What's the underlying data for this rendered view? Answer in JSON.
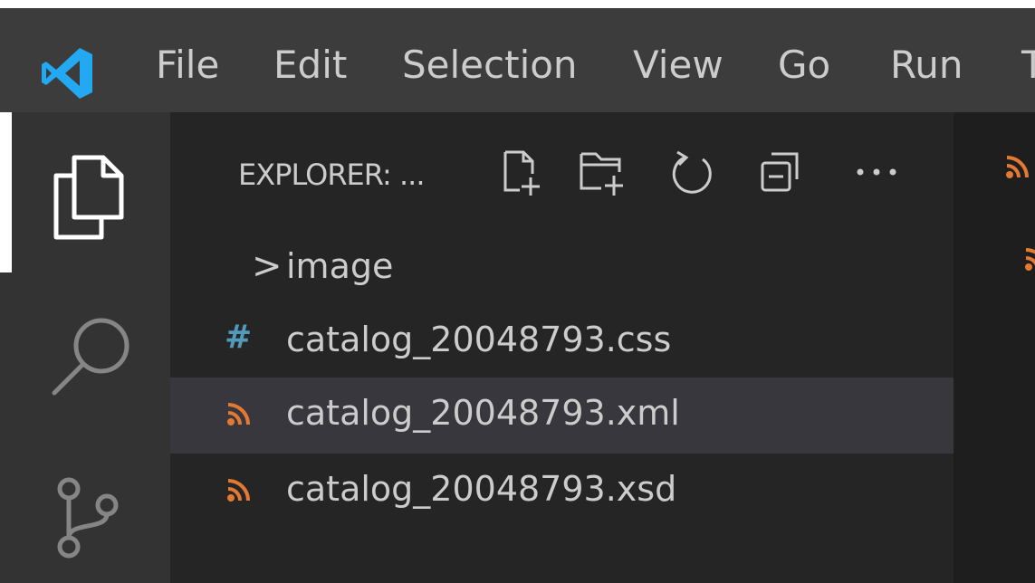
{
  "menubar": {
    "items": [
      "File",
      "Edit",
      "Selection",
      "View",
      "Go",
      "Run",
      "T"
    ]
  },
  "activitybar": {
    "icons": [
      "files-icon",
      "search-icon",
      "source-control-icon"
    ]
  },
  "explorer": {
    "title": "EXPLORER: ...",
    "actions": [
      "new-file-icon",
      "new-folder-icon",
      "refresh-icon",
      "collapse-all-icon",
      "more-actions-icon"
    ],
    "items": [
      {
        "label": "image",
        "kind": "folder",
        "icon": "chevron-right-icon"
      },
      {
        "label": "catalog_20048793.css",
        "kind": "file",
        "icon": "#"
      },
      {
        "label": "catalog_20048793.xml",
        "kind": "file",
        "icon": "rss-icon",
        "selected": true
      },
      {
        "label": "catalog_20048793.xsd",
        "kind": "file",
        "icon": "rss-icon"
      }
    ],
    "chevron": ">"
  },
  "colors": {
    "menubar": "#3c3c3c",
    "activitybar": "#333333",
    "sidebar": "#252526",
    "selected": "#37373d",
    "editor": "#1e1e1e",
    "accent_blue": "#23a9f2",
    "css_icon": "#519aba",
    "xml_icon": "#e37933"
  }
}
